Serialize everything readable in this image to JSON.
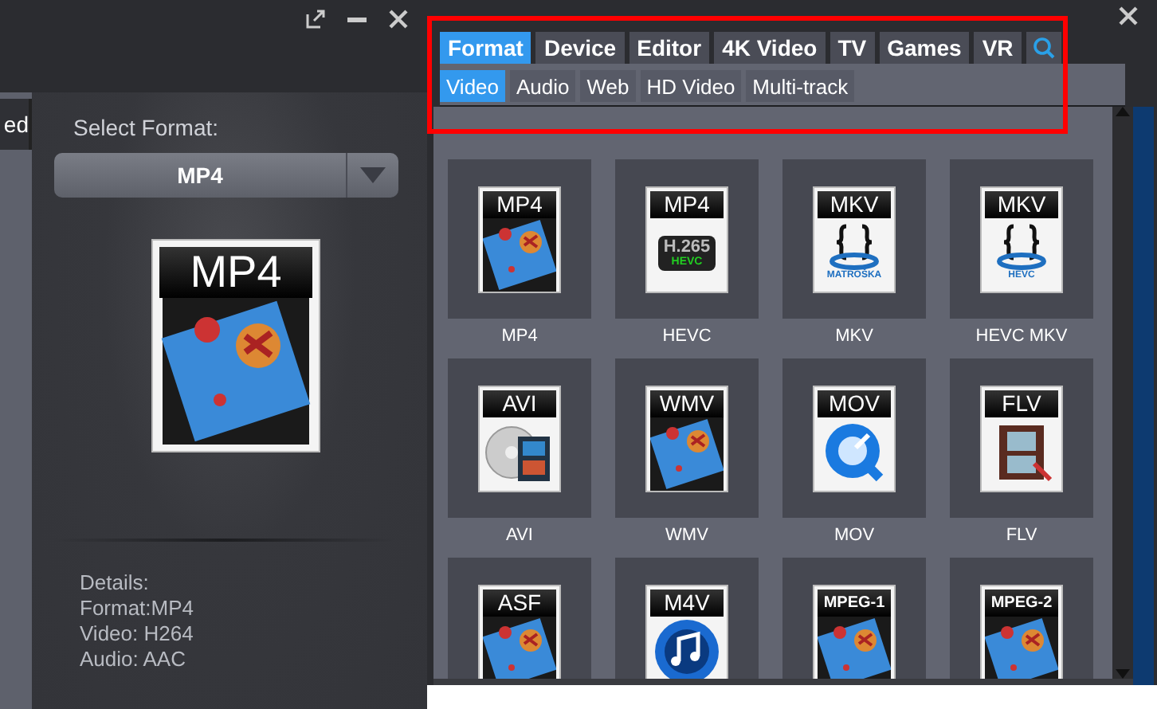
{
  "window_controls": {
    "left": [
      {
        "kind": "popout"
      },
      {
        "kind": "minimize"
      },
      {
        "kind": "close"
      }
    ],
    "right": [
      {
        "kind": "close"
      }
    ]
  },
  "side_tab": {
    "label": "ed"
  },
  "select_format": {
    "label": "Select Format:",
    "value": "MP4"
  },
  "preview": {
    "badge": "MP4",
    "kind": "film"
  },
  "details": [
    "Details:",
    "Format:MP4",
    "Video: H264",
    "Audio: AAC"
  ],
  "tabs_panel": {
    "highlighted": true
  },
  "tabs": [
    {
      "label": "Format",
      "selected": true
    },
    {
      "label": "Device",
      "selected": false
    },
    {
      "label": "Editor",
      "selected": false
    },
    {
      "label": "4K Video",
      "selected": false
    },
    {
      "label": "TV",
      "selected": false
    },
    {
      "label": "Games",
      "selected": false
    },
    {
      "label": "VR",
      "selected": false
    }
  ],
  "subtabs": [
    {
      "label": "Video",
      "selected": true
    },
    {
      "label": "Audio",
      "selected": false
    },
    {
      "label": "Web",
      "selected": false
    },
    {
      "label": "HD Video",
      "selected": false
    },
    {
      "label": "Multi-track",
      "selected": false
    }
  ],
  "formats": [
    {
      "badge": "MP4",
      "kind": "film",
      "caption": "MP4"
    },
    {
      "badge": "MP4",
      "kind": "h265",
      "inner": [
        "H.265",
        "HEVC"
      ],
      "caption": "HEVC"
    },
    {
      "badge": "MKV",
      "kind": "matroska",
      "inner": [
        "MATROŠKA"
      ],
      "caption": "MKV"
    },
    {
      "badge": "MKV",
      "kind": "matroska",
      "inner": [
        "HEVC"
      ],
      "caption": "HEVC MKV"
    },
    {
      "badge": "AVI",
      "kind": "disc",
      "caption": "AVI"
    },
    {
      "badge": "WMV",
      "kind": "film",
      "caption": "WMV"
    },
    {
      "badge": "MOV",
      "kind": "quicktime",
      "caption": "MOV"
    },
    {
      "badge": "FLV",
      "kind": "reel",
      "caption": "FLV"
    },
    {
      "badge": "ASF",
      "kind": "film"
    },
    {
      "badge": "M4V",
      "kind": "music"
    },
    {
      "badge": "MPEG-1",
      "kind": "film"
    },
    {
      "badge": "MPEG-2",
      "kind": "film"
    }
  ]
}
